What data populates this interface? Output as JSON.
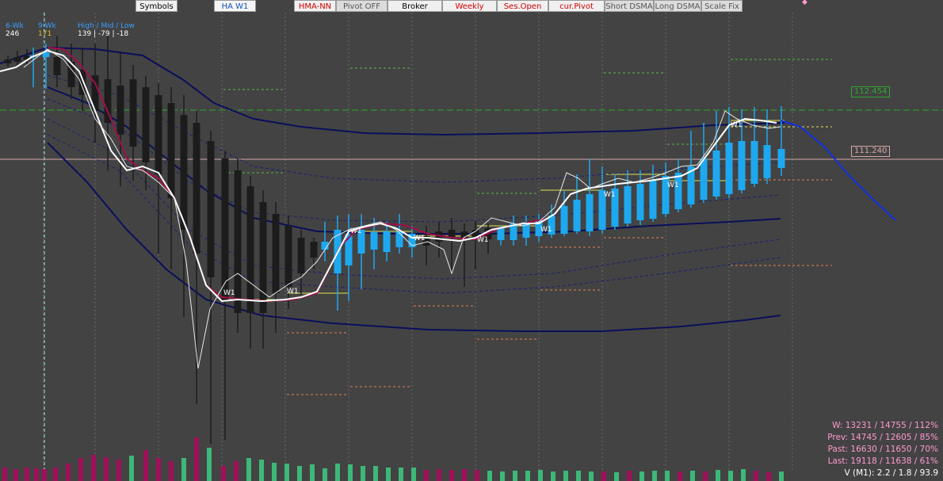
{
  "toolbar": {
    "buttons": [
      {
        "label": "Symbols",
        "style": "normal"
      },
      {
        "label": "HA W1",
        "style": "blue"
      },
      {
        "label": "HMA-NN",
        "style": "red"
      },
      {
        "label": "Pivot OFF",
        "style": "dark"
      },
      {
        "label": "Broker",
        "style": "normal"
      },
      {
        "label": "Weekly",
        "style": "red"
      },
      {
        "label": "Ses.Open",
        "style": "red"
      },
      {
        "label": "cur.Pivot",
        "style": "red"
      },
      {
        "label": "Short DSMA",
        "style": "dark"
      },
      {
        "label": "Long DSMA",
        "style": "dark"
      },
      {
        "label": "Scale Fix",
        "style": "dark"
      }
    ]
  },
  "info_panel": {
    "col1_label": "6-Wk",
    "col1_value": "246",
    "col2_label": "9-Wk",
    "col2_value": "171",
    "col3_label": "High / Mid / Low",
    "col3_value": "139  |  -79  |  -18"
  },
  "price_labels": {
    "upper": "112.454",
    "current": "111.240"
  },
  "candle_labels": {
    "w1": "W1"
  },
  "stats": {
    "w": "W: 13231 / 14755 / 112%",
    "prev": "Prev: 14745 / 12605 / 85%",
    "past": "Past: 16630 / 11650 / 70%",
    "last": "Last: 19118 / 11638 / 61%",
    "vol": "V (M1): 2.2 / 1.8 / 93.9"
  },
  "colors": {
    "background": "#434343",
    "bear_candle": "#1c1c1c",
    "bull_candle": "#1ea8f0",
    "envelope": "#0a0f5a",
    "hma": "#a0104a",
    "price_line": "#ffffff",
    "forecast": "#1030e0",
    "vol_up": "#3cb878",
    "vol_down": "#a0105a",
    "stats_text": "#ff9ad0",
    "upper_level": "#2fa82f",
    "current_level": "#d8a8a8"
  }
}
